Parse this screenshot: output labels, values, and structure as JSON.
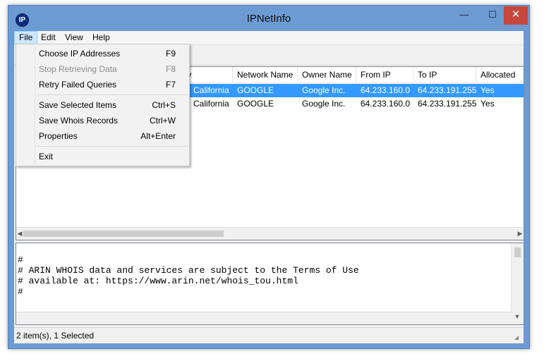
{
  "window": {
    "title": "IPNetInfo",
    "icon_text": "IP",
    "min_glyph": "—",
    "max_glyph": "☐",
    "close_glyph": "✕"
  },
  "menubar": {
    "file": "File",
    "edit": "Edit",
    "view": "View",
    "help": "Help"
  },
  "file_menu": {
    "items": [
      {
        "label": "Choose IP Addresses",
        "shortcut": "F9",
        "enabled": true
      },
      {
        "label": "Stop Retrieving Data",
        "shortcut": "F8",
        "enabled": false
      },
      {
        "label": "Retry Failed Queries",
        "shortcut": "F7",
        "enabled": true
      },
      {
        "label": "Save Selected Items",
        "shortcut": "Ctrl+S",
        "enabled": true
      },
      {
        "label": "Save Whois Records",
        "shortcut": "Ctrl+W",
        "enabled": true
      },
      {
        "label": "Properties",
        "shortcut": "Alt+Enter",
        "enabled": true
      },
      {
        "label": "Exit",
        "shortcut": "",
        "enabled": true
      }
    ]
  },
  "listview": {
    "columns": [
      "try",
      "Network Name",
      "Owner Name",
      "From IP",
      "To IP",
      "Allocated"
    ],
    "rows": [
      [
        "California",
        "GOOGLE",
        "Google Inc.",
        "64.233.160.0",
        "64.233.191.255",
        "Yes"
      ],
      [
        "California",
        "GOOGLE",
        "Google Inc.",
        "64.233.160.0",
        "64.233.191.255",
        "Yes"
      ]
    ]
  },
  "whois_text": {
    "lines": [
      "#",
      "# ARIN WHOIS data and services are subject to the Terms of Use",
      "# available at: https://www.arin.net/whois_tou.html",
      "#"
    ]
  },
  "statusbar": {
    "text": "2 item(s), 1 Selected"
  },
  "colors": {
    "selection": "#3399ff",
    "close_button": "#c7463e",
    "frame": "#6c9ad2"
  }
}
